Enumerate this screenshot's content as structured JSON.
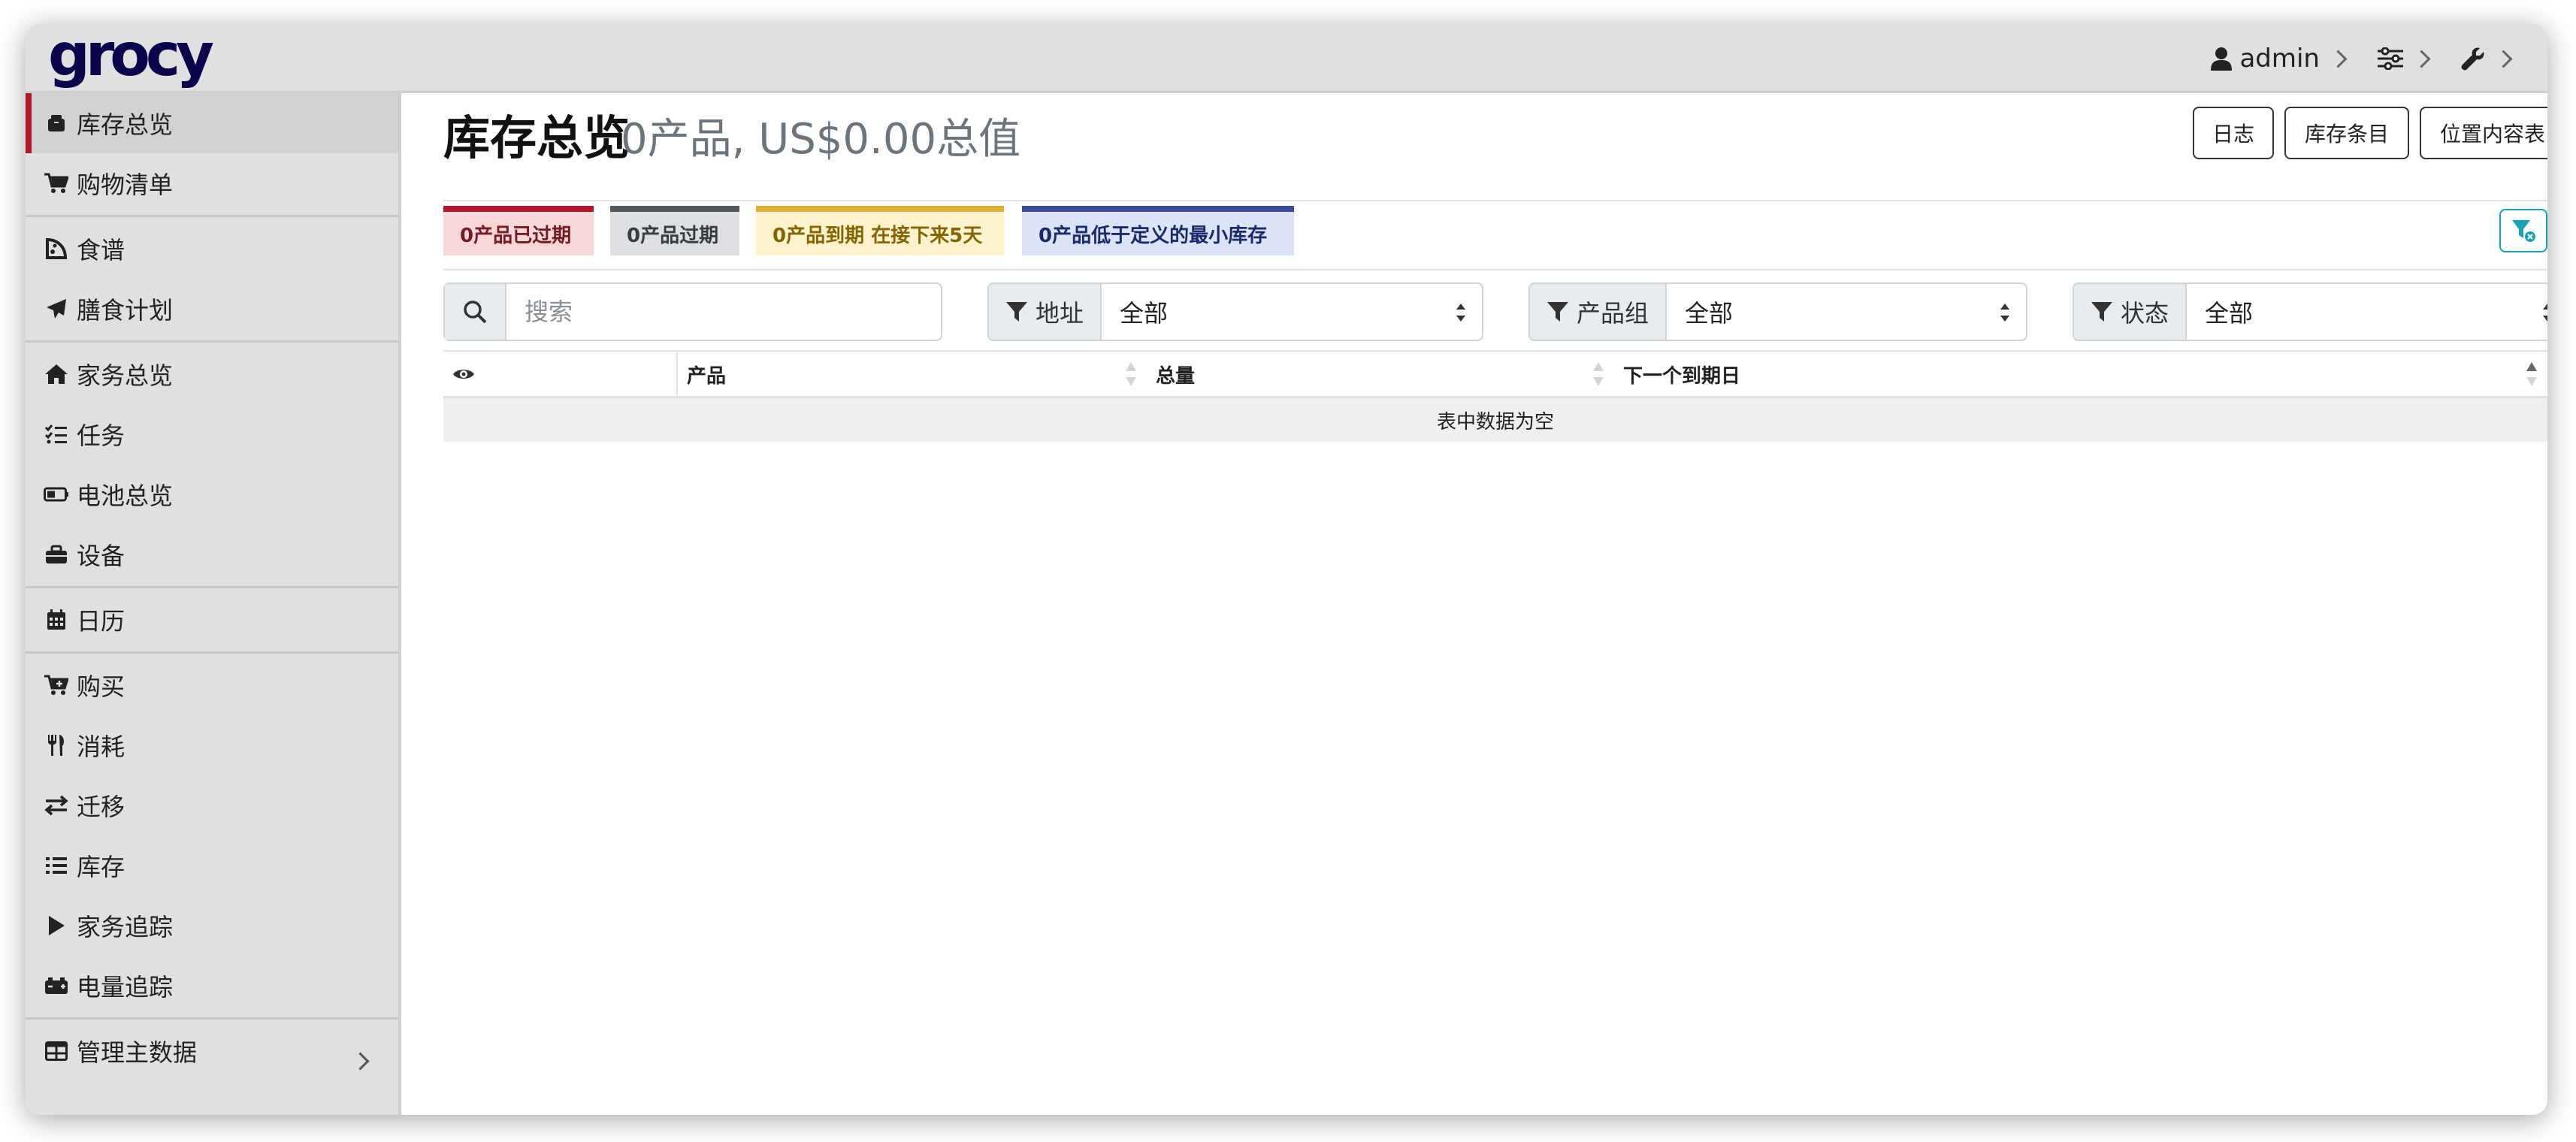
{
  "app": {
    "logo": "grocy"
  },
  "topnav": {
    "user": "admin"
  },
  "sidebar": {
    "items": [
      {
        "label": "库存总览",
        "icon": "box-icon"
      },
      {
        "label": "购物清单",
        "icon": "cart-icon"
      },
      {
        "label": "食谱",
        "icon": "pizza-icon"
      },
      {
        "label": "膳食计划",
        "icon": "paper-plane-icon"
      },
      {
        "label": "家务总览",
        "icon": "home-icon"
      },
      {
        "label": "任务",
        "icon": "tasks-icon"
      },
      {
        "label": "电池总览",
        "icon": "battery-icon"
      },
      {
        "label": "设备",
        "icon": "toolbox-icon"
      },
      {
        "label": "日历",
        "icon": "calendar-icon"
      },
      {
        "label": "购买",
        "icon": "cart-plus-icon"
      },
      {
        "label": "消耗",
        "icon": "utensils-icon"
      },
      {
        "label": "迁移",
        "icon": "exchange-icon"
      },
      {
        "label": "库存",
        "icon": "list-icon"
      },
      {
        "label": "家务追踪",
        "icon": "play-icon"
      },
      {
        "label": "电量追踪",
        "icon": "car-battery-icon"
      },
      {
        "label": "管理主数据",
        "icon": "table-icon"
      }
    ]
  },
  "page": {
    "title": "库存总览",
    "subtitle": "0产品, US$0.00总值"
  },
  "toolbar": {
    "journal": "日志",
    "stock_entries": "库存条目",
    "location_content": "位置内容表"
  },
  "badges": {
    "expired": "0产品已过期",
    "overdue": "0产品过期",
    "due_soon": "0产品到期 在接下来5天",
    "below_min": "0产品低于定义的最小库存"
  },
  "filters": {
    "search_placeholder": "搜索",
    "location_label": "地址",
    "location_value": "全部",
    "product_group_label": "产品组",
    "product_group_value": "全部",
    "status_label": "状态",
    "status_value": "全部"
  },
  "table": {
    "columns": [
      "",
      "产品",
      "总量",
      "下一个到期日"
    ],
    "empty_text": "表中数据为空"
  },
  "colors": {
    "accent_red": "#b1172a",
    "logo_navy": "#0b024c",
    "info_teal": "#17a2b8"
  }
}
